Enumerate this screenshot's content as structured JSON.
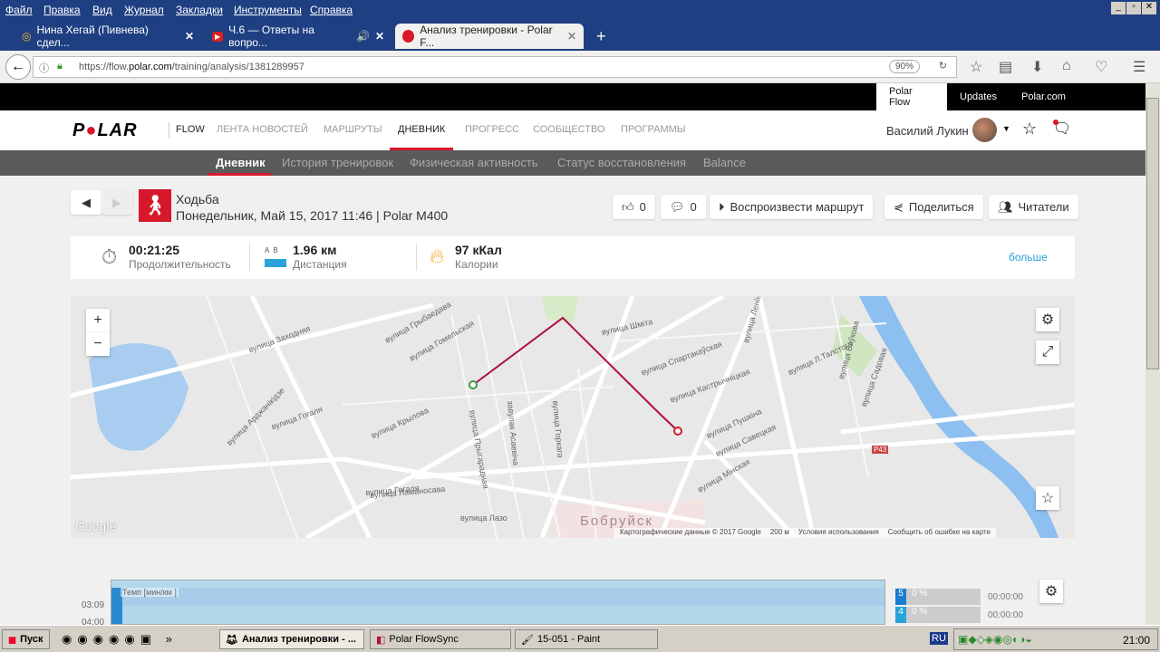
{
  "menubar": [
    "Файл",
    "Правка",
    "Вид",
    "Журнал",
    "Закладки",
    "Инструменты",
    "Справка"
  ],
  "tabs": [
    {
      "title": "Нина Хегай (Пивнева) сдел...",
      "icon": "mail-icon"
    },
    {
      "title": "Ч.6 — Ответы на вопро...",
      "icon": "youtube-icon"
    },
    {
      "title": "Анализ тренировки - Polar F...",
      "icon": "polar-icon"
    }
  ],
  "url": {
    "prefix": "https://flow.",
    "domain": "polar.com",
    "path": "/training/analysis/1381289957",
    "zoom": "90%"
  },
  "topbar": [
    "Polar Flow",
    "Updates",
    "Polar.com"
  ],
  "brand": {
    "logo": "POLAR",
    "flow": "FLOW",
    "accent": "#d7182a"
  },
  "mainnav": [
    "ЛЕНТА НОВОСТЕЙ",
    "МАРШРУТЫ",
    "ДНЕВНИК",
    "ПРОГРЕСС",
    "СООБЩЕСТВО",
    "ПРОГРАММЫ"
  ],
  "user": {
    "name": "Василий Лукин"
  },
  "subnav": [
    "Дневник",
    "История тренировок",
    "Физическая активность",
    "Статус восстановления",
    "Balance"
  ],
  "training": {
    "sport": "Ходьба",
    "details": "Понедельник, Май 15, 2017 11:46 | Polar M400"
  },
  "actions": {
    "likes": "0",
    "comments": "0",
    "replay": "Воспроизвести маршрут",
    "share": "Поделиться",
    "readers": "Читатели"
  },
  "summary": {
    "duration": "00:21:25",
    "duration_label": "Продолжительность",
    "ab": "A  B",
    "distance": "1.96 км",
    "distance_label": "Дистанция",
    "calories": "97 кКал",
    "calories_label": "Калории",
    "more": "больше"
  },
  "map": {
    "city": "Бобруйск",
    "streets": [
      "вулица Гогаля",
      "вулица Крылова",
      "вулица Ламаносава",
      "вулица Гогаля",
      "вулица Лазо",
      "вулица Шміта",
      "вулица Спартакаўская",
      "вулица Кастрычніцкая",
      "вулица Пушкіна",
      "вулица Савецкая",
      "вулица Мінская",
      "вулица Леніна",
      "вулица Садовая",
      "вулица Ваўкова",
      "вулица Л.Талстога",
      "вулица Заходняя",
      "вулица Арджанікідзе",
      "вулица Грыбаедава",
      "вулица Гомельская",
      "вулица Прыгарадная",
      "завулак Асаевіча",
      "вулица Горкага"
    ],
    "road": "P43",
    "google": "Google",
    "attribution": "Картографические данные © 2017 Google",
    "scale": "200 м",
    "terms": "Условия использования",
    "report": "Сообщить об ошибке на карте"
  },
  "chart": {
    "label": "Темп [мин/км ]",
    "ticks": [
      "03:09",
      "04:00"
    ]
  },
  "zones": [
    {
      "zone": "5",
      "pct": "0 %",
      "time": "00:00:00"
    },
    {
      "zone": "4",
      "pct": "0 %",
      "time": "00:00:00"
    }
  ],
  "taskbar": {
    "start": "Пуск",
    "items": [
      "Анализ тренировки - ...",
      "Polar FlowSync",
      "15-051 - Paint"
    ],
    "lang": "RU",
    "clock": "21:00"
  }
}
